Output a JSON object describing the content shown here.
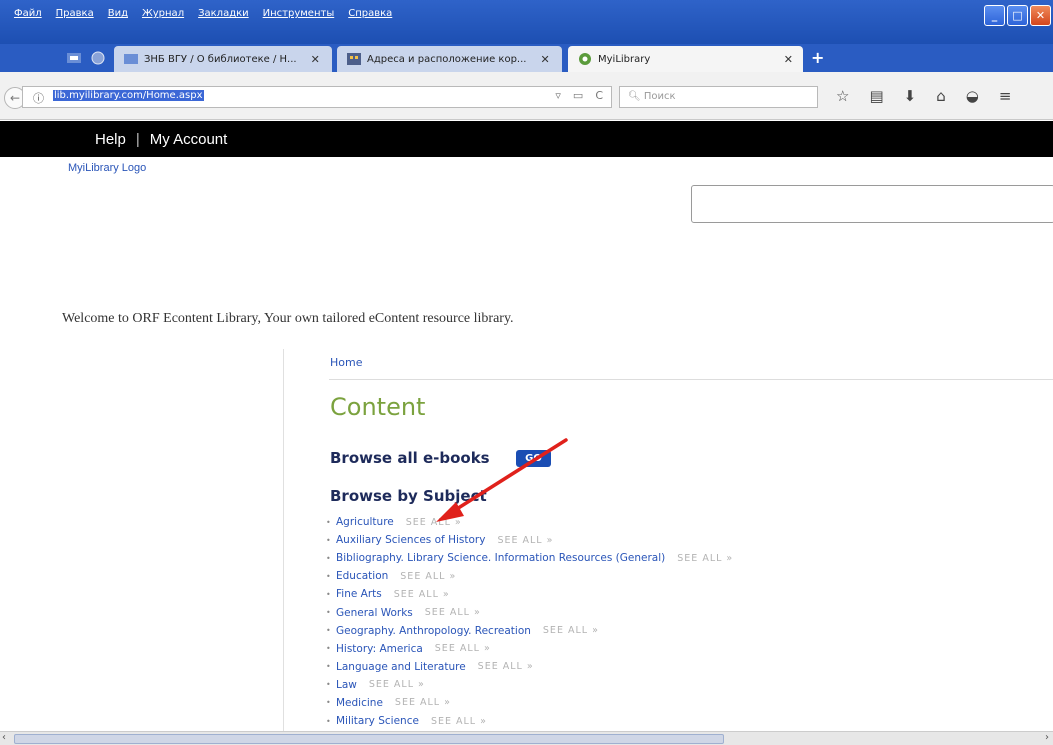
{
  "browser": {
    "menu": [
      "Файл",
      "Правка",
      "Вид",
      "Журнал",
      "Закладки",
      "Инструменты",
      "Справка"
    ],
    "tabs": [
      {
        "label": "ЗНБ ВГУ / О библиотеке / Н...",
        "close": "✕"
      },
      {
        "label": "Адреса и расположение кор...",
        "close": "✕"
      },
      {
        "label": "MyiLibrary",
        "close": "✕"
      }
    ],
    "new_tab": "+",
    "url": "lib.myilibrary.com/Home.aspx",
    "search_placeholder": "Поиск"
  },
  "page": {
    "nav": {
      "help": "Help",
      "separator": "|",
      "account": "My Account"
    },
    "logo_alt": "MyiLibrary Logo",
    "welcome": "Welcome to ORF Econtent Library, Your own tailored eContent resource library.",
    "breadcrumb": "Home",
    "content_title": "Content",
    "browse_all_label": "Browse all e-books",
    "go_label": "GO",
    "browse_subject_label": "Browse by Subject",
    "see_all": "SEE ALL »",
    "subjects": [
      "Agriculture",
      "Auxiliary Sciences of History",
      "Bibliography. Library Science. Information Resources (General)",
      "Education",
      "Fine Arts",
      "General Works",
      "Geography. Anthropology. Recreation",
      "History: America",
      "Language and Literature",
      "Law",
      "Medicine",
      "Military Science"
    ]
  },
  "colors": {
    "link": "#2a55b8",
    "title_green": "#7ba23e",
    "heading_navy": "#1d2a5a",
    "go_button": "#1a4db3",
    "annotation_arrow": "#e0211b"
  }
}
